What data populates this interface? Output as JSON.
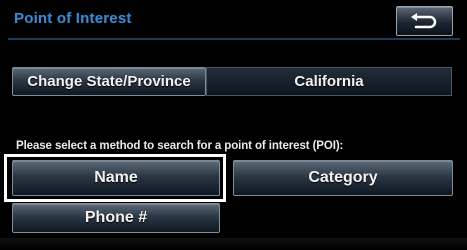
{
  "header": {
    "title": "Point of Interest",
    "back_icon": "return-arrow-icon"
  },
  "state_row": {
    "change_button": "Change State/Province",
    "current_value": "California"
  },
  "instruction": "Please select a method to search for a point of interest (POI):",
  "methods": {
    "name": "Name",
    "category": "Category",
    "phone": "Phone #"
  },
  "colors": {
    "title": "#3f86c8",
    "highlight": "#ffffff",
    "background": "#000000"
  }
}
